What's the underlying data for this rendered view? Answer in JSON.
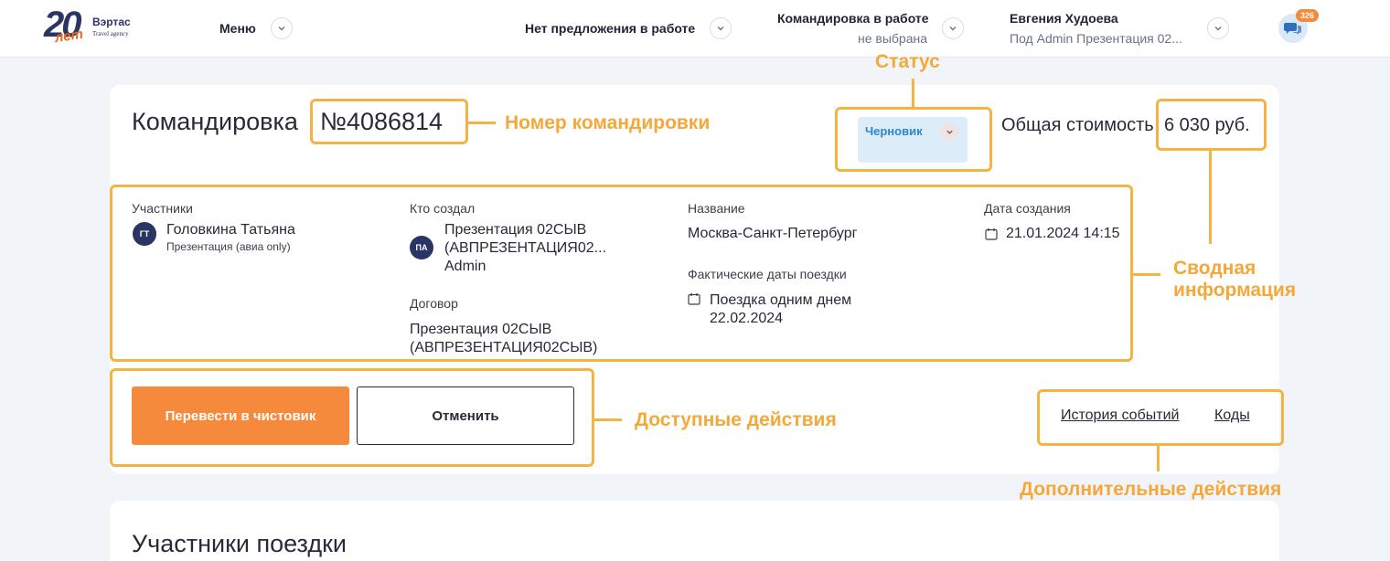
{
  "header": {
    "brand": "Вэртас",
    "brand_sub": "Travel agency",
    "logo_years": "20",
    "logo_word": "лет",
    "menu_label": "Меню",
    "offer_label": "Нет предложения в работе",
    "trip_title": "Командировка в работе",
    "trip_sub": "не выбрана",
    "user_name": "Евгения Худоева",
    "user_sub": "Под Admin Презентация 02...",
    "chat_count": "326"
  },
  "trip": {
    "title_prefix": "Командировка",
    "number": "№4086814",
    "status": "Черновик",
    "total_label": "Общая стоимость",
    "total_value": "6 030 руб."
  },
  "summary": {
    "participants_label": "Участники",
    "participant_initials": "ГТ",
    "participant_name": "Головкина Татьяна",
    "participant_sub": "Презентация (авиа only)",
    "creator_label": "Кто создал",
    "creator_initials": "ПА",
    "creator_line1": "Презентация 02СЫВ",
    "creator_line2": "(АВПРЕЗЕНТАЦИЯ02...",
    "creator_line3": "Admin",
    "contract_label": "Договор",
    "contract_line1": "Презентация 02СЫВ",
    "contract_line2": "(АВПРЕЗЕНТАЦИЯ02СЫВ)",
    "name_label": "Название",
    "name_value": "Москва-Санкт-Петербург",
    "dates_label": "Фактические даты поездки",
    "dates_line1": "Поездка одним днем",
    "dates_line2": "22.02.2024",
    "created_label": "Дата создания",
    "created_value": "21.01.2024 14:15"
  },
  "actions": {
    "primary": "Перевести в чистовик",
    "secondary": "Отменить",
    "history_link": "История событий",
    "codes_link": "Коды"
  },
  "sections": {
    "participants_title": "Участники поездки"
  },
  "annotations": {
    "status": "Статус",
    "number": "Номер командировки",
    "summary_line1": "Сводная",
    "summary_line2": "информация",
    "actions": "Доступные действия",
    "extra": "Дополнительные действия"
  },
  "colors": {
    "accent": "#f58a3c",
    "annotation": "#f5b442",
    "status_bg": "#dcecf9",
    "status_text": "#2d86d4"
  }
}
